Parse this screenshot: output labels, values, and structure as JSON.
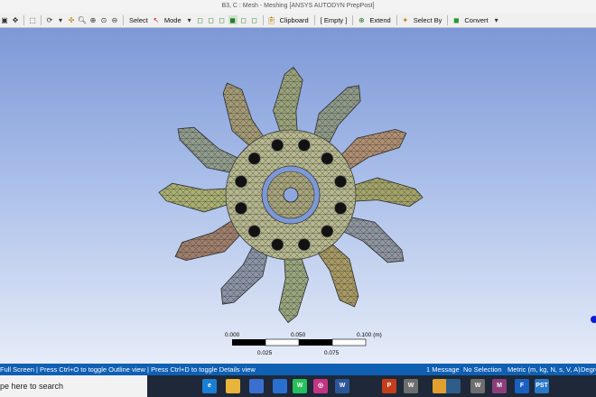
{
  "window": {
    "title": "B3, C : Mesh - Meshing [ANSYS AUTODYN PrepPost]"
  },
  "toolbar": {
    "select_label": "Select",
    "mode_label": "Mode",
    "clipboard_label": "Clipboard",
    "empty_label": "[ Empty ]",
    "extend_label": "Extend",
    "select_by_label": "Select By",
    "convert_label": "Convert"
  },
  "scale_bar": {
    "top_labels": [
      "0.000",
      "0.050",
      "0.100 (m)"
    ],
    "bottom_labels": [
      "0.025",
      "0.075"
    ]
  },
  "status_bar": {
    "hint": "Full Screen | Press Ctrl+O to toggle Outline view | Press Ctrl+D to toggle Details view",
    "messages": "1 Message",
    "selection": "No Selection",
    "units": "Metric (m, kg, N, s, V, A)",
    "degrees": "Degre"
  },
  "taskbar": {
    "search_placeholder": "pe here to search",
    "apps": [
      {
        "name": "cortana",
        "label": "",
        "color": "#1e2838"
      },
      {
        "name": "task-view",
        "label": "",
        "color": "#1e2838"
      },
      {
        "name": "edge",
        "label": "e",
        "color": "#1a7fd4"
      },
      {
        "name": "file-explorer",
        "label": "",
        "color": "#e8b53a"
      },
      {
        "name": "store",
        "label": "",
        "color": "#3a6fd0"
      },
      {
        "name": "mail",
        "label": "",
        "color": "#2a6fd0"
      },
      {
        "name": "whatsapp",
        "label": "W",
        "color": "#25c05a"
      },
      {
        "name": "instagram",
        "label": "◎",
        "color": "#c13584"
      },
      {
        "name": "word",
        "label": "W",
        "color": "#2b579a"
      },
      {
        "name": "powerpoint",
        "label": "P",
        "color": "#c43e1c"
      },
      {
        "name": "workbench",
        "label": "W",
        "color": "#6e6e6e"
      },
      {
        "name": "chrome",
        "label": "",
        "color": "#e0a030"
      },
      {
        "name": "mechanical",
        "label": "",
        "color": "#2e5d8a"
      },
      {
        "name": "workbench-2",
        "label": "W",
        "color": "#6e6e6e"
      },
      {
        "name": "meshing",
        "label": "M",
        "color": "#8b3f7a"
      },
      {
        "name": "fluent",
        "label": "F",
        "color": "#1a60c0"
      },
      {
        "name": "prepost",
        "label": "PST",
        "color": "#2a78c8"
      }
    ]
  },
  "colors": {
    "viewport_top": "#7d98d6",
    "viewport_bottom": "#e6ecf8",
    "statusbar": "#0f5fb3",
    "taskbar": "#1e2838"
  }
}
